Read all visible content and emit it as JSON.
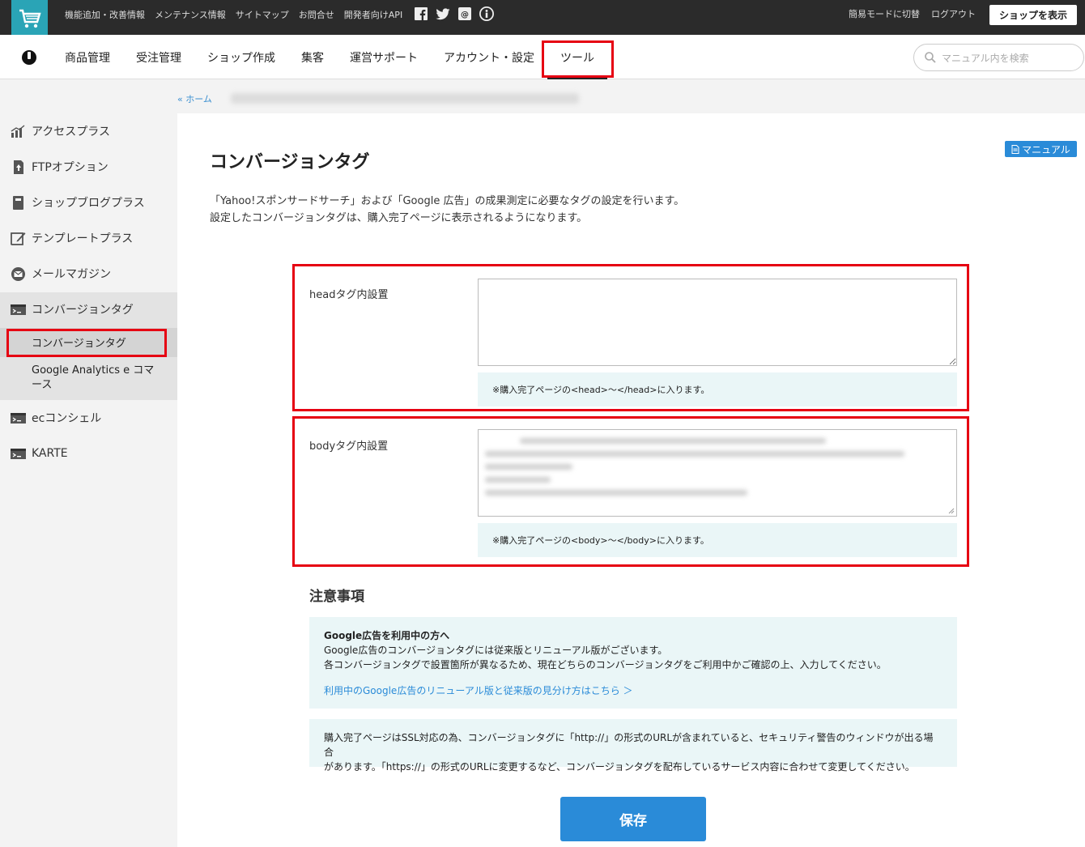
{
  "topbar": {
    "links": [
      "機能追加・改善情報",
      "メンテナンス情報",
      "サイトマップ",
      "お問合せ",
      "開発者向けAPI"
    ],
    "right_links": [
      "簡易モードに切替",
      "ログアウト"
    ],
    "shop_button": "ショップを表示",
    "social_icons": [
      "facebook-icon",
      "twitter-icon",
      "mail-icon",
      "info-icon"
    ]
  },
  "nav": {
    "items": [
      "商品管理",
      "受注管理",
      "ショップ作成",
      "集客",
      "運営サポート",
      "アカウント・設定",
      "ツール"
    ],
    "active": "ツール",
    "search_placeholder": "マニュアル内を検索"
  },
  "breadcrumb": {
    "home": "« ホーム"
  },
  "sidebar": {
    "items": [
      {
        "label": "アクセスプラス",
        "icon": "chart-icon"
      },
      {
        "label": "FTPオプション",
        "icon": "upload-file-icon"
      },
      {
        "label": "ショップブログプラス",
        "icon": "notebook-icon"
      },
      {
        "label": "テンプレートプラス",
        "icon": "edit-icon"
      },
      {
        "label": "メールマガジン",
        "icon": "mail-icon"
      },
      {
        "label": "コンバージョンタグ",
        "icon": "terminal-icon"
      },
      {
        "label": "ecコンシェル",
        "icon": "terminal-icon"
      },
      {
        "label": "KARTE",
        "icon": "terminal-icon"
      }
    ],
    "subitems": [
      "コンバージョンタグ",
      "Google Analytics e コマース"
    ]
  },
  "main": {
    "manual_button": "マニュアル",
    "title": "コンバージョンタグ",
    "desc_line1": "「Yahoo!スポンサードサーチ」および「Google 広告」の成果測定に必要なタグの設定を行います。",
    "desc_line2": "設定したコンバージョンタグは、購入完了ページに表示されるようになります。",
    "head_label": "headタグ内設置",
    "head_value": "",
    "head_note": "※購入完了ページの<head>〜</head>に入ります。",
    "body_label": "bodyタグ内設置",
    "body_note": "※購入完了ページの<body>〜</body>に入ります。",
    "caution_title": "注意事項",
    "caution1_title": "Google広告を利用中の方へ",
    "caution1_line1": "Google広告のコンバージョンタグには従来版とリニューアル版がございます。",
    "caution1_line2": "各コンバージョンタグで設置箇所が異なるため、現在どちらのコンバージョンタグをご利用中かご確認の上、入力してください。",
    "caution1_link": "利用中のGoogle広告のリニューアル版と従来版の見分け方はこちら ＞",
    "caution2_line1": "購入完了ページはSSL対応の為、コンバージョンタグに「http://」の形式のURLが含まれていると、セキュリティ警告のウィンドウが出る場合",
    "caution2_line2": "があります。「https://」の形式のURLに変更するなど、コンバージョンタグを配布しているサービス内容に合わせて変更してください。",
    "save_button": "保存"
  },
  "colors": {
    "accent_blue": "#2a8bd8",
    "highlight_red": "#e60012",
    "logo_teal": "#2aa4b6"
  }
}
